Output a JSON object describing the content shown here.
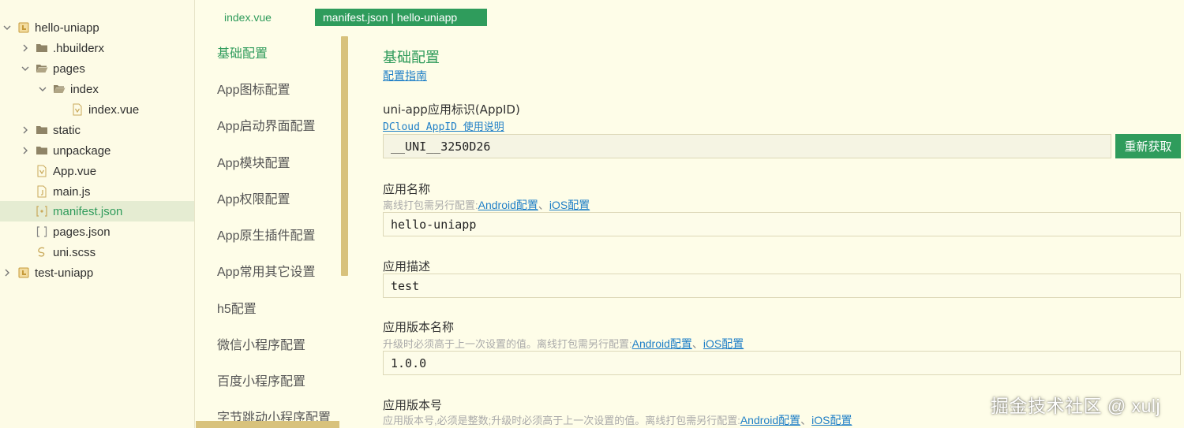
{
  "colors": {
    "accent": "#2f9c5c",
    "link": "#1f7fc7",
    "selection": "#e5ecd2",
    "scrollbar": "#d8c27c",
    "background": "#fefde8"
  },
  "file_tree": {
    "items": [
      {
        "label": "hello-uniapp",
        "icon": "project-icon",
        "chevron": "down"
      },
      {
        "label": ".hbuilderx",
        "icon": "folder-icon",
        "chevron": "right"
      },
      {
        "label": "pages",
        "icon": "folder-open-icon",
        "chevron": "down"
      },
      {
        "label": "index",
        "icon": "folder-open-icon",
        "chevron": "down"
      },
      {
        "label": "index.vue",
        "icon": "vue-file-icon",
        "chevron": "none"
      },
      {
        "label": "static",
        "icon": "folder-icon",
        "chevron": "right"
      },
      {
        "label": "unpackage",
        "icon": "folder-icon",
        "chevron": "right"
      },
      {
        "label": "App.vue",
        "icon": "vue-file-icon",
        "chevron": "none"
      },
      {
        "label": "main.js",
        "icon": "js-file-icon",
        "chevron": "none"
      },
      {
        "label": "manifest.json",
        "icon": "json-file-icon",
        "chevron": "none",
        "selected": true
      },
      {
        "label": "pages.json",
        "icon": "json-bracket-icon",
        "chevron": "none"
      },
      {
        "label": "uni.scss",
        "icon": "sass-file-icon",
        "chevron": "none"
      },
      {
        "label": "test-uniapp",
        "icon": "project-icon",
        "chevron": "right"
      }
    ]
  },
  "tabs": [
    {
      "label": "index.vue",
      "active": false
    },
    {
      "label": "manifest.json | hello-uniapp",
      "active": true
    }
  ],
  "config_nav": {
    "items": [
      {
        "label": "基础配置",
        "active": true
      },
      {
        "label": "App图标配置"
      },
      {
        "label": "App启动界面配置"
      },
      {
        "label": "App模块配置"
      },
      {
        "label": "App权限配置"
      },
      {
        "label": "App原生插件配置"
      },
      {
        "label": "App常用其它设置"
      },
      {
        "label": "h5配置"
      },
      {
        "label": "微信小程序配置"
      },
      {
        "label": "百度小程序配置"
      },
      {
        "label": "字节跳动小程序配置"
      }
    ]
  },
  "form": {
    "section_title": "基础配置",
    "guide_link": "配置指南",
    "appid": {
      "label": "uni-app应用标识(AppID)",
      "help_link": "DCloud AppID 使用说明",
      "value": "__UNI__3250D26",
      "button": "重新获取"
    },
    "app_name": {
      "label": "应用名称",
      "hint": "离线打包需另行配置: ",
      "android_link": "Android配置",
      "separator": "、",
      "ios_link": "iOS配置",
      "value": "hello-uniapp"
    },
    "app_desc": {
      "label": "应用描述",
      "value": "test"
    },
    "version_name": {
      "label": "应用版本名称",
      "hint": "升级时必须高于上一次设置的值。离线打包需另行配置: ",
      "android_link": "Android配置",
      "separator": "、",
      "ios_link": "iOS配置",
      "value": "1.0.0"
    },
    "version_code": {
      "label": "应用版本号",
      "hint": "应用版本号,必须是整数;升级时必须高于上一次设置的值。离线打包需另行配置: ",
      "android_link": "Android配置",
      "separator": "、",
      "ios_link": "iOS配置"
    }
  },
  "watermark": "掘金技术社区 @ xulj"
}
